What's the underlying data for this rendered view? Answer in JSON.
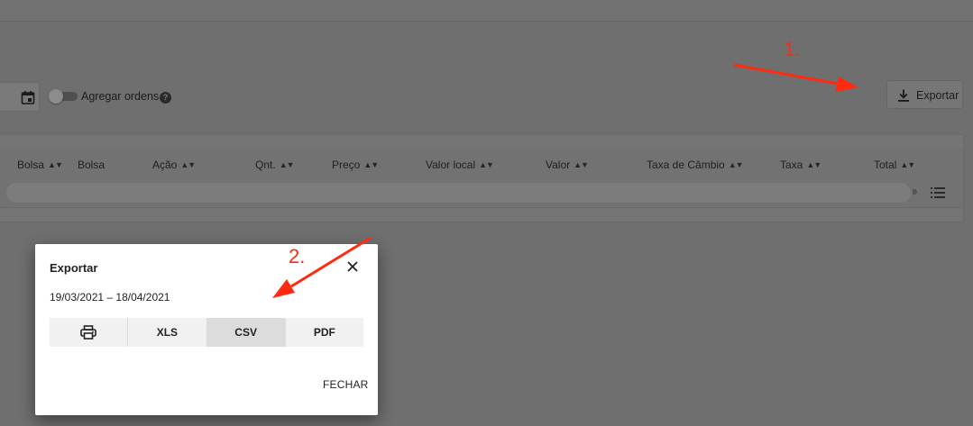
{
  "filters": {
    "calendar_icon": "calendar-icon",
    "aggregate_label": "Agregar ordens",
    "aggregate_enabled": false,
    "help_icon": "?"
  },
  "toolbar": {
    "export_label": "Exportar",
    "export_icon": "download-icon"
  },
  "table": {
    "columns": [
      {
        "label": "Bolsa",
        "sortable": true
      },
      {
        "label": "Bolsa",
        "sortable": false
      },
      {
        "label": "Ação",
        "sortable": true
      },
      {
        "label": "Qnt.",
        "sortable": true
      },
      {
        "label": "Preço",
        "sortable": true
      },
      {
        "label": "Valor local",
        "sortable": true
      },
      {
        "label": "Valor",
        "sortable": true
      },
      {
        "label": "Taxa de Câmbio",
        "sortable": true
      },
      {
        "label": "Taxa",
        "sortable": true
      },
      {
        "label": "Total",
        "sortable": true
      }
    ],
    "sort_glyph": "◆",
    "row_state": "loading",
    "row_menu_icon": "list-icon"
  },
  "export_dialog": {
    "title": "Exportar",
    "date_range": "19/03/2021 – 18/04/2021",
    "formats": [
      {
        "label": "",
        "icon": "print-icon",
        "active": false
      },
      {
        "label": "XLS",
        "active": false
      },
      {
        "label": "CSV",
        "active": true
      },
      {
        "label": "PDF",
        "active": false
      }
    ],
    "close_label": "FECHAR"
  },
  "annotations": {
    "step1": "1.",
    "step2": "2.",
    "color": "#ff2a10"
  },
  "colors": {
    "overlay": "#6f6f6f",
    "dialog_bg": "#ffffff",
    "active_segment": "#dcdcdc"
  }
}
